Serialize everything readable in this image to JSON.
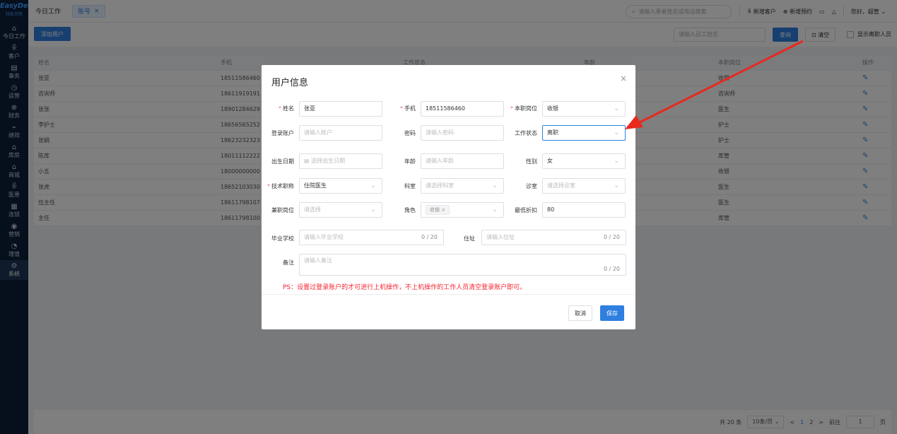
{
  "app": {
    "logo_main": "EasyDent",
    "logo_sub": "轻松牙医"
  },
  "sidebar": {
    "items": [
      {
        "label": "今日工作",
        "icon": "⌂"
      },
      {
        "label": "客户",
        "icon": "ꆜ"
      },
      {
        "label": "事务",
        "icon": "▤"
      },
      {
        "label": "运营",
        "icon": "◷"
      },
      {
        "label": "财务",
        "icon": "⊗"
      },
      {
        "label": "绩效",
        "icon": "⌁"
      },
      {
        "label": "库房",
        "icon": "⌂"
      },
      {
        "label": "商城",
        "icon": "⌂"
      },
      {
        "label": "医患",
        "icon": "ꆜ"
      },
      {
        "label": "连锁",
        "icon": "▦"
      },
      {
        "label": "营销",
        "icon": "◉"
      },
      {
        "label": "增值",
        "icon": "◔"
      },
      {
        "label": "系统",
        "icon": "⚙"
      }
    ]
  },
  "topbar": {
    "tab_home": "今日工作",
    "tab_active": "账号",
    "tab_close": "×",
    "search_placeholder": "请输入患者姓名或电话搜索",
    "new_customer": "新增客户",
    "new_booking": "新增预约",
    "greeting": "您好，超管"
  },
  "toolbar": {
    "add_user": "添加用户",
    "staff_search_placeholder": "请输入员工姓名",
    "query": "查询",
    "clear": "清空",
    "clear_icon": "⊡",
    "show_left": "显示离职人员"
  },
  "table": {
    "headers": [
      "姓名",
      "手机",
      "工作状态",
      "年龄",
      "本职岗位",
      "操作"
    ],
    "rows": [
      {
        "name": "张亚",
        "phone": "18511586460",
        "post": "收银"
      },
      {
        "name": "咨询师",
        "phone": "18611919191",
        "post": "咨询师"
      },
      {
        "name": "张张",
        "phone": "18901284629",
        "post": "医生"
      },
      {
        "name": "李护士",
        "phone": "18656565252",
        "post": "护士"
      },
      {
        "name": "张娟",
        "phone": "18623232323",
        "post": "护士"
      },
      {
        "name": "陈库",
        "phone": "18011112222",
        "post": "库管"
      },
      {
        "name": "小五",
        "phone": "18000000000",
        "post": "收银"
      },
      {
        "name": "张虎",
        "phone": "18652103030",
        "post": "医生"
      },
      {
        "name": "伍主任",
        "phone": "18611798107",
        "post": "医生"
      },
      {
        "name": "主任",
        "phone": "18611798100",
        "post": "库管"
      }
    ]
  },
  "pager": {
    "total": "共 20 条",
    "page_size": "10条/页",
    "prev": "<",
    "next": ">",
    "pages": [
      "1",
      "2"
    ],
    "goto": "前往",
    "goto_value": "1",
    "page_unit": "页"
  },
  "dialog": {
    "title": "用户信息",
    "close": "×",
    "fields": {
      "name_label": "姓名",
      "name_value": "张亚",
      "phone_label": "手机",
      "phone_value": "18511586460",
      "post_label": "本职岗位",
      "post_value": "收银",
      "account_label": "登录账户",
      "account_placeholder": "请输入账户",
      "password_label": "密码",
      "password_placeholder": "请输入密码",
      "status_label": "工作状态",
      "status_value": "离职",
      "birth_label": "出生日期",
      "birth_placeholder": "选择出生日期",
      "age_label": "年龄",
      "age_placeholder": "请输入年龄",
      "gender_label": "性别",
      "gender_value": "女",
      "title_label": "技术职称",
      "title_value": "住院医生",
      "dept_label": "科室",
      "dept_placeholder": "请选择科室",
      "room_label": "诊室",
      "room_placeholder": "请选择诊室",
      "parttime_label": "兼职岗位",
      "parttime_placeholder": "请选择",
      "role_label": "角色",
      "role_tag": "收银",
      "discount_label": "最低折扣",
      "discount_value": "80",
      "school_label": "毕业学校",
      "school_placeholder": "请输入毕业学校",
      "school_count": "0 / 20",
      "address_label": "住址",
      "address_placeholder": "请输入住址",
      "address_count": "0 / 20",
      "remark_label": "备注",
      "remark_placeholder": "请输入备注",
      "remark_count": "0 / 20"
    },
    "ps_note": "PS：设置过登录账户的才可进行上机操作，不上机操作的工作人员清空登录账户即可。",
    "cancel": "取消",
    "save": "保存"
  },
  "colors": {
    "primary": "#2f7fe0",
    "sidebar": "#0d1e38",
    "required": "#f56c6c",
    "annotation": "#e8291c"
  }
}
